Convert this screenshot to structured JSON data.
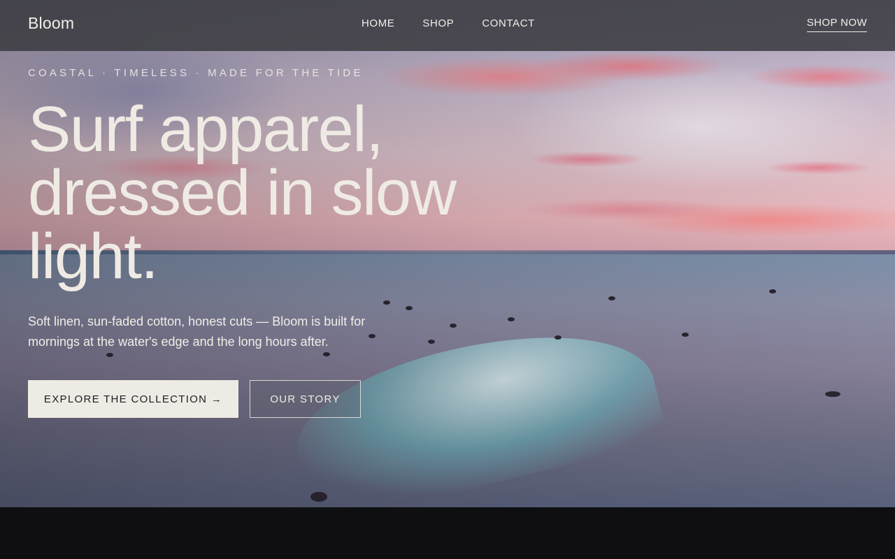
{
  "brand": {
    "name": "Bloom"
  },
  "nav": {
    "items": [
      {
        "label": "HOME"
      },
      {
        "label": "SHOP"
      },
      {
        "label": "CONTACT"
      }
    ],
    "cta_label": "SHOP NOW"
  },
  "hero": {
    "eyebrow": "COASTAL · TIMELESS · MADE FOR THE TIDE",
    "headline": "Surf apparel, dressed in slow light.",
    "subtext": "Soft linen, sun-faded cotton, honest cuts — Bloom is built for mornings at the water's edge and the long hours after.",
    "primary_button": "EXPLORE THE COLLECTION →",
    "secondary_button": "OUR STORY",
    "background_image": "surfers-at-sunset-photo"
  },
  "colors": {
    "header_bg": "#3c3c42",
    "text_light": "#efebe4",
    "button_light": "#eeebe5",
    "page_dark": "#0f0f12"
  }
}
